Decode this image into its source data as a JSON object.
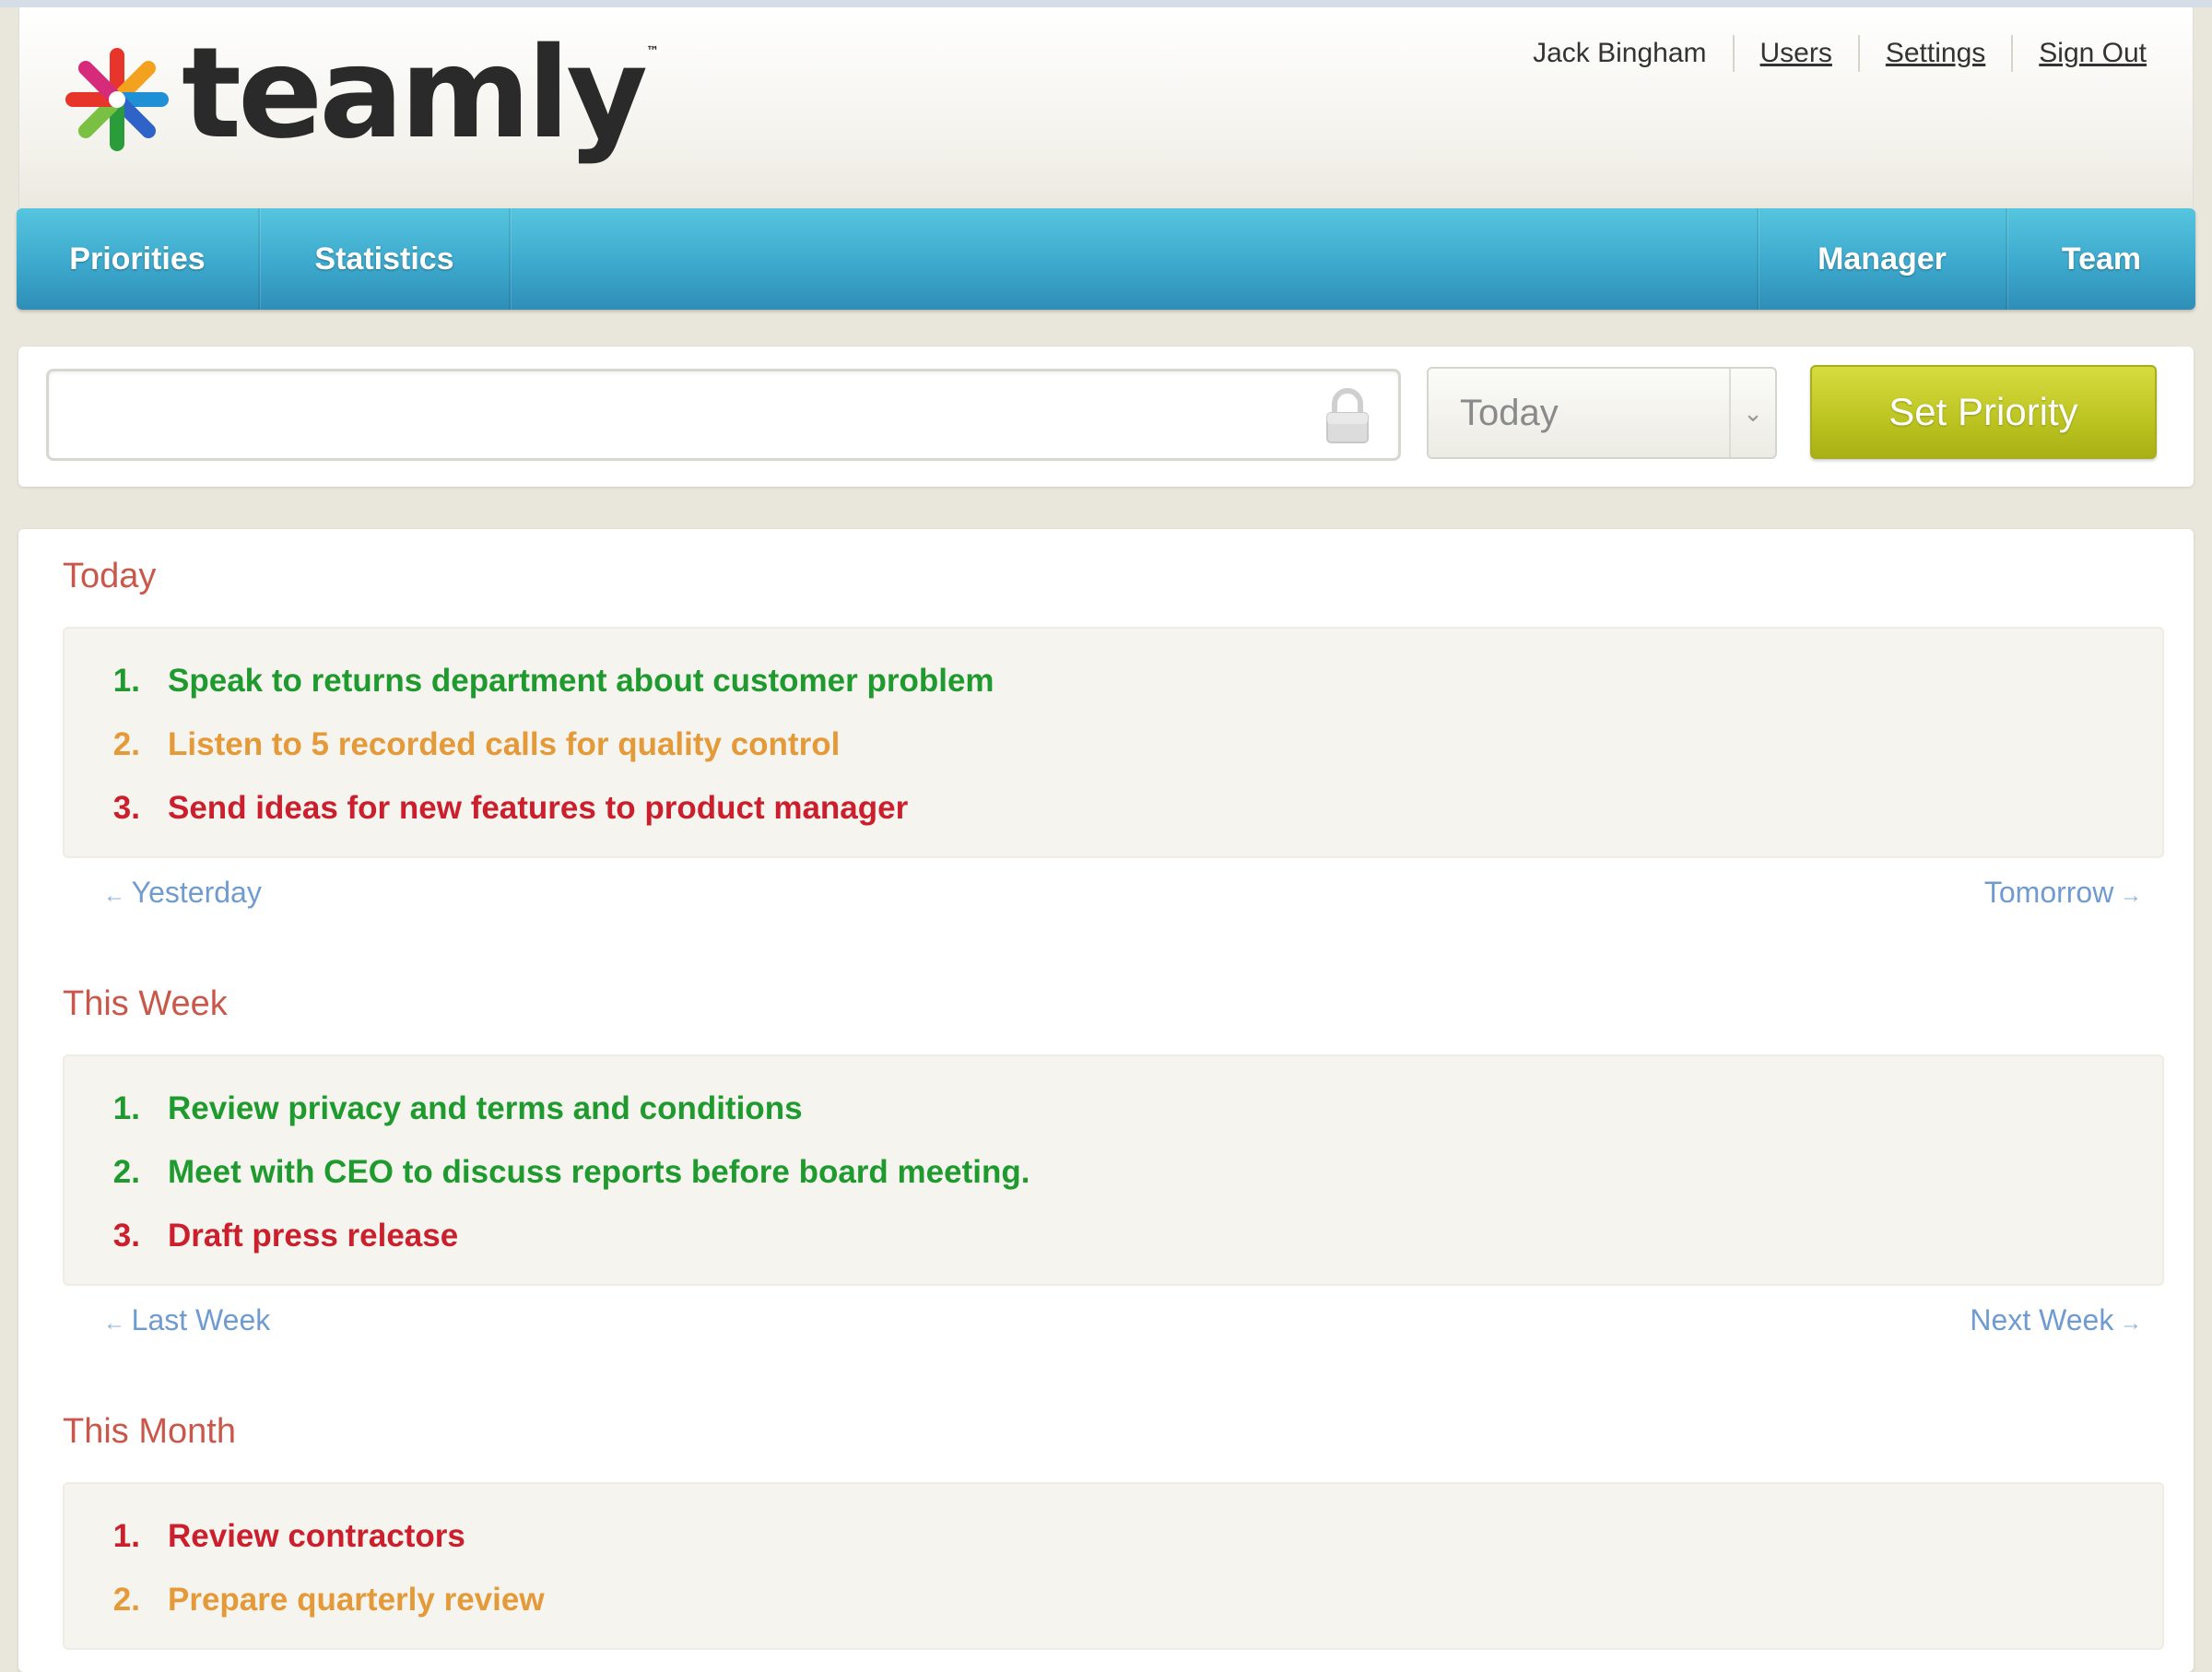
{
  "brand": {
    "name": "teamly",
    "trademark": "™"
  },
  "header": {
    "user_name": "Jack Bingham",
    "links": {
      "users": "Users",
      "settings": "Settings",
      "sign_out": "Sign Out"
    }
  },
  "nav": {
    "priorities": "Priorities",
    "statistics": "Statistics",
    "manager": "Manager",
    "team": "Team"
  },
  "entry": {
    "input_value": "",
    "input_placeholder": "",
    "when_selected": "Today",
    "submit_label": "Set Priority"
  },
  "colors": {
    "nav_blue": "#3da9cd",
    "button_lime": "#bcc421",
    "high_priority_green": "#1f9a2e",
    "medium_priority_orange": "#e59a3a",
    "low_priority_red": "#cc1f2d",
    "section_title": "#c9584a",
    "pager_link": "#6f9bd0"
  },
  "sections": {
    "today": {
      "title": "Today",
      "items": [
        {
          "num": "1.",
          "text": "Speak to returns department about customer problem",
          "color": "green"
        },
        {
          "num": "2.",
          "text": "Listen to 5 recorded calls for quality control",
          "color": "orange"
        },
        {
          "num": "3.",
          "text": "Send ideas for new features to product manager",
          "color": "red"
        }
      ],
      "prev": "Yesterday",
      "next": "Tomorrow"
    },
    "week": {
      "title": "This Week",
      "items": [
        {
          "num": "1.",
          "text": "Review privacy and terms and conditions",
          "color": "green"
        },
        {
          "num": "2.",
          "text": "Meet with CEO to discuss reports before board meeting.",
          "color": "green"
        },
        {
          "num": "3.",
          "text": "Draft press release",
          "color": "red"
        }
      ],
      "prev": "Last Week",
      "next": "Next Week"
    },
    "month": {
      "title": "This Month",
      "items": [
        {
          "num": "1.",
          "text": "Review contractors",
          "color": "red"
        },
        {
          "num": "2.",
          "text": "Prepare quarterly review",
          "color": "orange"
        }
      ]
    }
  }
}
